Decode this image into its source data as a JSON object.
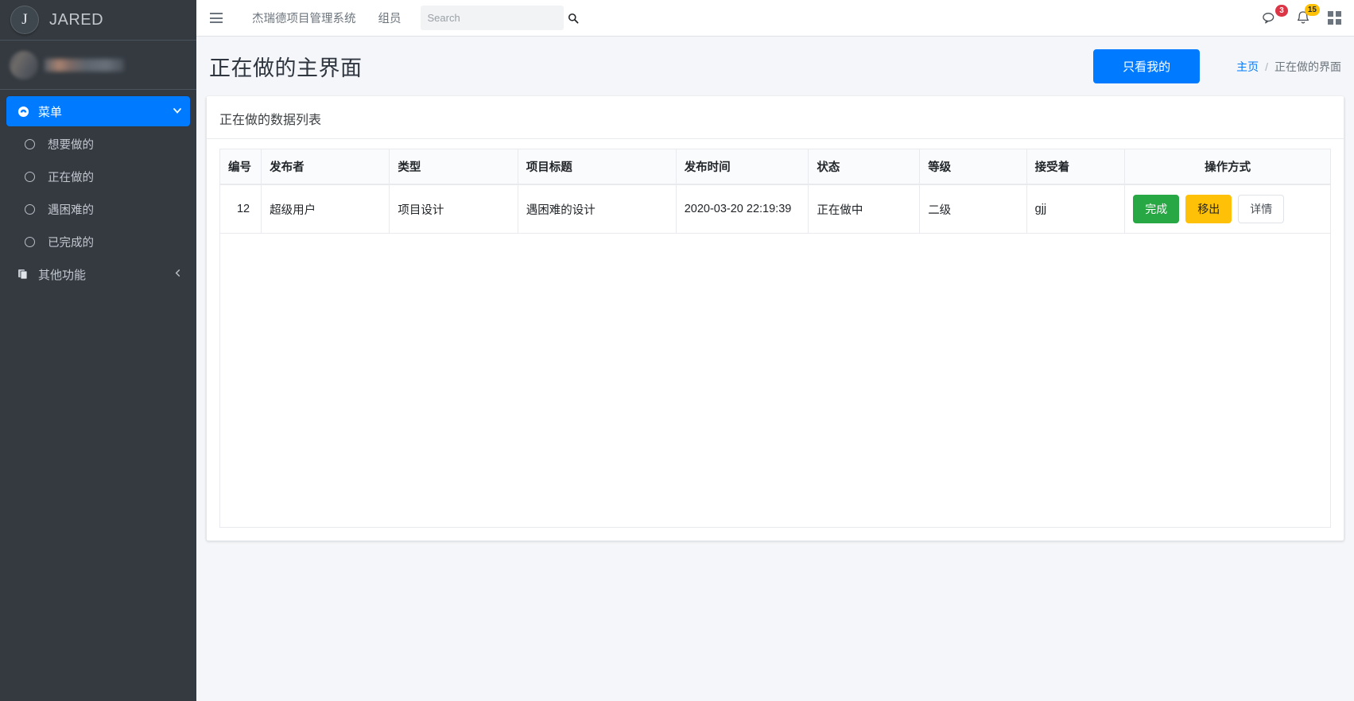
{
  "sidebar": {
    "brand": {
      "logo_letter": "J",
      "title": "JARED"
    },
    "user": {
      "name_blurred": true
    },
    "menu": {
      "label": "菜单",
      "icon": "dashboard-icon",
      "arrow": "chevron-down-icon"
    },
    "items": [
      {
        "label": "想要做的",
        "icon": "circle-icon"
      },
      {
        "label": "正在做的",
        "icon": "circle-icon"
      },
      {
        "label": "遇困难的",
        "icon": "circle-icon"
      },
      {
        "label": "已完成的",
        "icon": "circle-icon"
      }
    ],
    "other": {
      "label": "其他功能",
      "icon": "copy-icon",
      "arrow": "chevron-left-icon"
    }
  },
  "navbar": {
    "hamburger": "hamburger-icon",
    "links": [
      {
        "label": "杰瑞德项目管理系统"
      },
      {
        "label": "组员"
      }
    ],
    "search": {
      "placeholder": "Search",
      "value": "",
      "icon": "search-icon"
    },
    "messages": {
      "icon": "chat-icon",
      "count": "3",
      "color": "#dc3545"
    },
    "notifications": {
      "icon": "bell-icon",
      "count": "15",
      "color": "#ffc107"
    },
    "apps": {
      "icon": "grid-icon"
    }
  },
  "header": {
    "title": "正在做的主界面",
    "action_button": "只看我的",
    "accent_color": "#007bff",
    "breadcrumb": {
      "home": "主页",
      "separator": "/",
      "current": "正在做的界面"
    }
  },
  "card": {
    "title": "正在做的数据列表"
  },
  "table": {
    "columns": [
      "编号",
      "发布者",
      "类型",
      "项目标题",
      "发布时间",
      "状态",
      "等级",
      "接受着",
      "操作方式"
    ],
    "rows": [
      {
        "id": "12",
        "publisher": "超级用户",
        "type": "项目设计",
        "title": "遇困难的设计",
        "publish_time": "2020-03-20 22:19:39",
        "status": "正在做中",
        "level": "二级",
        "acceptor": "gjj",
        "actions": [
          {
            "label": "完成",
            "style": "success",
            "color": "#28a745"
          },
          {
            "label": "移出",
            "style": "warning",
            "color": "#ffc107"
          },
          {
            "label": "详情",
            "style": "outline",
            "color": "#ffffff"
          }
        ]
      }
    ]
  }
}
